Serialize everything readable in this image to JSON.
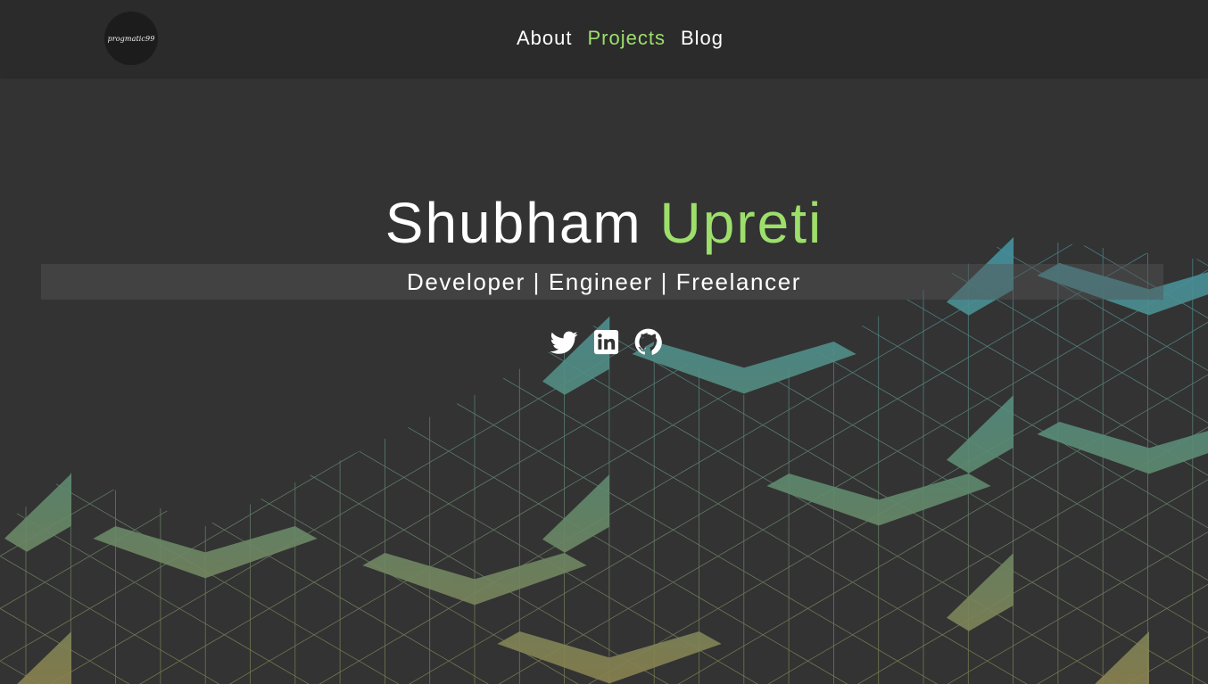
{
  "logo": {
    "text": "progmatic99"
  },
  "nav": {
    "links": [
      {
        "label": "About",
        "active": false
      },
      {
        "label": "Projects",
        "active": true
      },
      {
        "label": "Blog",
        "active": false
      }
    ]
  },
  "hero": {
    "first_name": "Shubham",
    "last_name": "Upreti",
    "tagline": "Developer | Engineer | Freelancer"
  },
  "socials": [
    {
      "icon": "twitter-icon"
    },
    {
      "icon": "linkedin-icon"
    },
    {
      "icon": "github-icon"
    }
  ],
  "colors": {
    "background": "#333333",
    "navbar": "#2b2b2b",
    "accent": "#9ddf6b",
    "pattern_top": "#3f8794",
    "pattern_bottom": "#7a7a4a"
  }
}
